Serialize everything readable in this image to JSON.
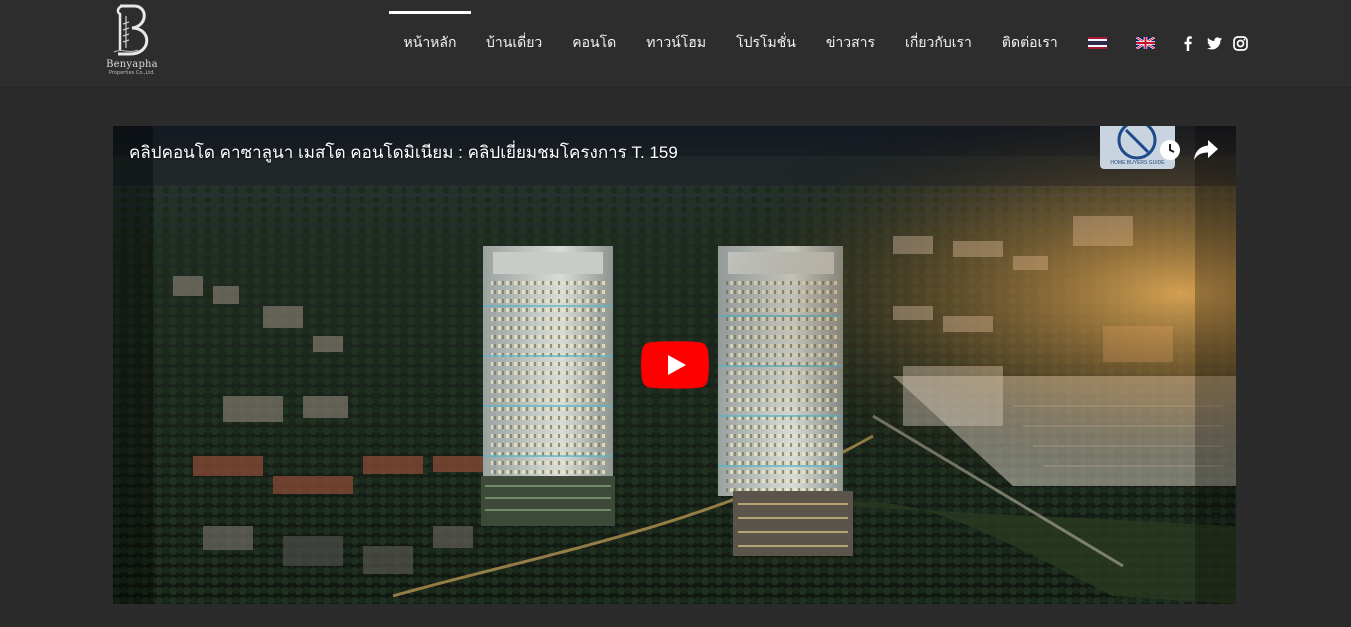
{
  "brand": {
    "name": "Benyapha",
    "subtitle": "Properties Co.,Ltd."
  },
  "nav": {
    "items": [
      {
        "label": "หน้าหลัก",
        "active": true
      },
      {
        "label": "บ้านเดี่ยว",
        "active": false
      },
      {
        "label": "คอนโด",
        "active": false
      },
      {
        "label": "ทาวน์โฮม",
        "active": false
      },
      {
        "label": "โปรโมชั่น",
        "active": false
      },
      {
        "label": "ข่าวสาร",
        "active": false
      },
      {
        "label": "เกี่ยวกับเรา",
        "active": false
      },
      {
        "label": "ติดต่อเรา",
        "active": false
      }
    ],
    "languages": [
      "thai-flag-icon",
      "uk-flag-icon"
    ],
    "social": [
      "facebook-icon",
      "twitter-icon",
      "instagram-icon"
    ]
  },
  "video": {
    "title": "คลิปคอนโด คาซาลูนา เมสโต คอนโดมิเนียม : คลิปเยี่ยมชมโครงการ T. 159",
    "watermark": "HOME BUYERS GUIDE",
    "controls": [
      "watch-later-icon",
      "share-icon",
      "play-icon"
    ]
  },
  "colors": {
    "header_bg": "#2d2d2d",
    "page_bg": "#2b2b2b",
    "play_red": "#ff0000",
    "text": "#f2f2f2"
  }
}
